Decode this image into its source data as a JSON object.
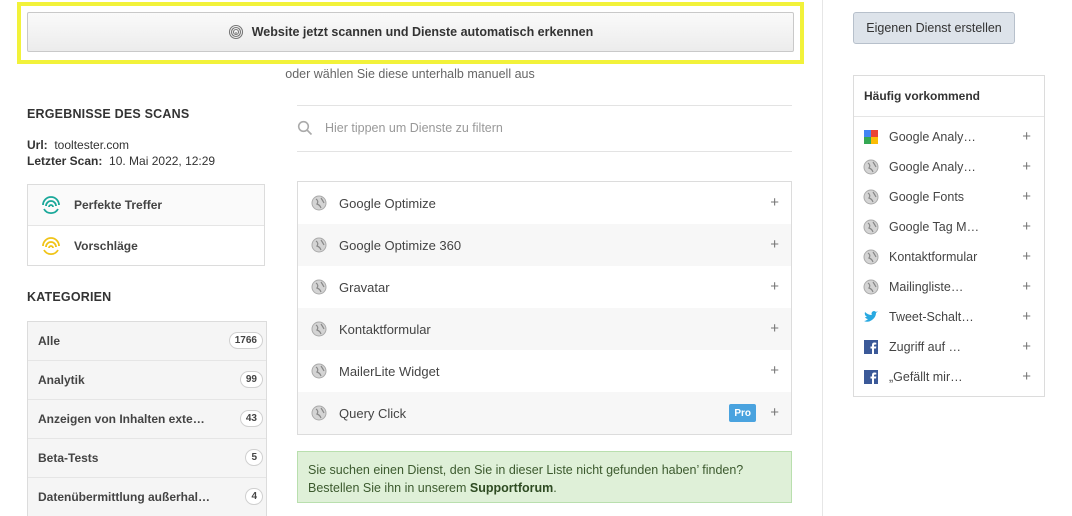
{
  "scan": {
    "button_label": "Website jetzt scannen und Dienste automatisch erkennen",
    "or_text": "oder wählen Sie diese unterhalb manuell aus"
  },
  "create_button": "Eigenen Dienst erstellen",
  "results": {
    "title": "ERGEBNISSE DES SCANS",
    "url_label": "Url:",
    "url_value": "tooltester.com",
    "lastscan_label": "Letzter Scan:",
    "lastscan_value": "10. Mai 2022, 12:29",
    "perfect_matches": "Perfekte Treffer",
    "suggestions": "Vorschläge"
  },
  "categories": {
    "title": "KATEGORIEN",
    "items": [
      {
        "label": "Alle",
        "count": "1766"
      },
      {
        "label": "Analytik",
        "count": "99"
      },
      {
        "label": "Anzeigen von Inhalten exte…",
        "count": "43"
      },
      {
        "label": "Beta-Tests",
        "count": "5"
      },
      {
        "label": "Datenübermittlung außerhal…",
        "count": "4"
      }
    ]
  },
  "filter": {
    "placeholder": "Hier tippen um Dienste zu filtern"
  },
  "services": [
    {
      "label": "Google Optimize",
      "pro": ""
    },
    {
      "label": "Google Optimize 360",
      "pro": ""
    },
    {
      "label": "Gravatar",
      "pro": ""
    },
    {
      "label": "Kontaktformular",
      "pro": ""
    },
    {
      "label": "MailerLite Widget",
      "pro": ""
    },
    {
      "label": "Query Click",
      "pro": "Pro"
    }
  ],
  "notice": {
    "line1": "Sie suchen einen Dienst, den Sie in dieser Liste nicht gefunden haben’ finden?",
    "line2_prefix": "Bestellen Sie ihn in unserem ",
    "line2_link": "Supportforum",
    "line2_suffix": "."
  },
  "frequent": {
    "title": "Häufig vorkommend",
    "items": [
      {
        "label": "Google Analy…",
        "icon": "google-icon"
      },
      {
        "label": "Google Analy…",
        "icon": "globe-icon"
      },
      {
        "label": "Google Fonts",
        "icon": "globe-icon"
      },
      {
        "label": "Google Tag M…",
        "icon": "globe-icon"
      },
      {
        "label": "Kontaktformular",
        "icon": "globe-icon"
      },
      {
        "label": "Mailingliste…",
        "icon": "globe-icon"
      },
      {
        "label": "Tweet-Schalt…",
        "icon": "twitter-icon"
      },
      {
        "label": "Zugriff auf …",
        "icon": "facebook-icon"
      },
      {
        "label": "„Gefällt mir…",
        "icon": "facebook-icon"
      }
    ]
  },
  "plus_symbol": "+",
  "colors": {
    "highlight": "#f2f23a",
    "accent_teal": "#1aa89a",
    "accent_yellow": "#f0c419",
    "pro_badge": "#4aa3df",
    "notice_bg": "#dff0d8"
  }
}
